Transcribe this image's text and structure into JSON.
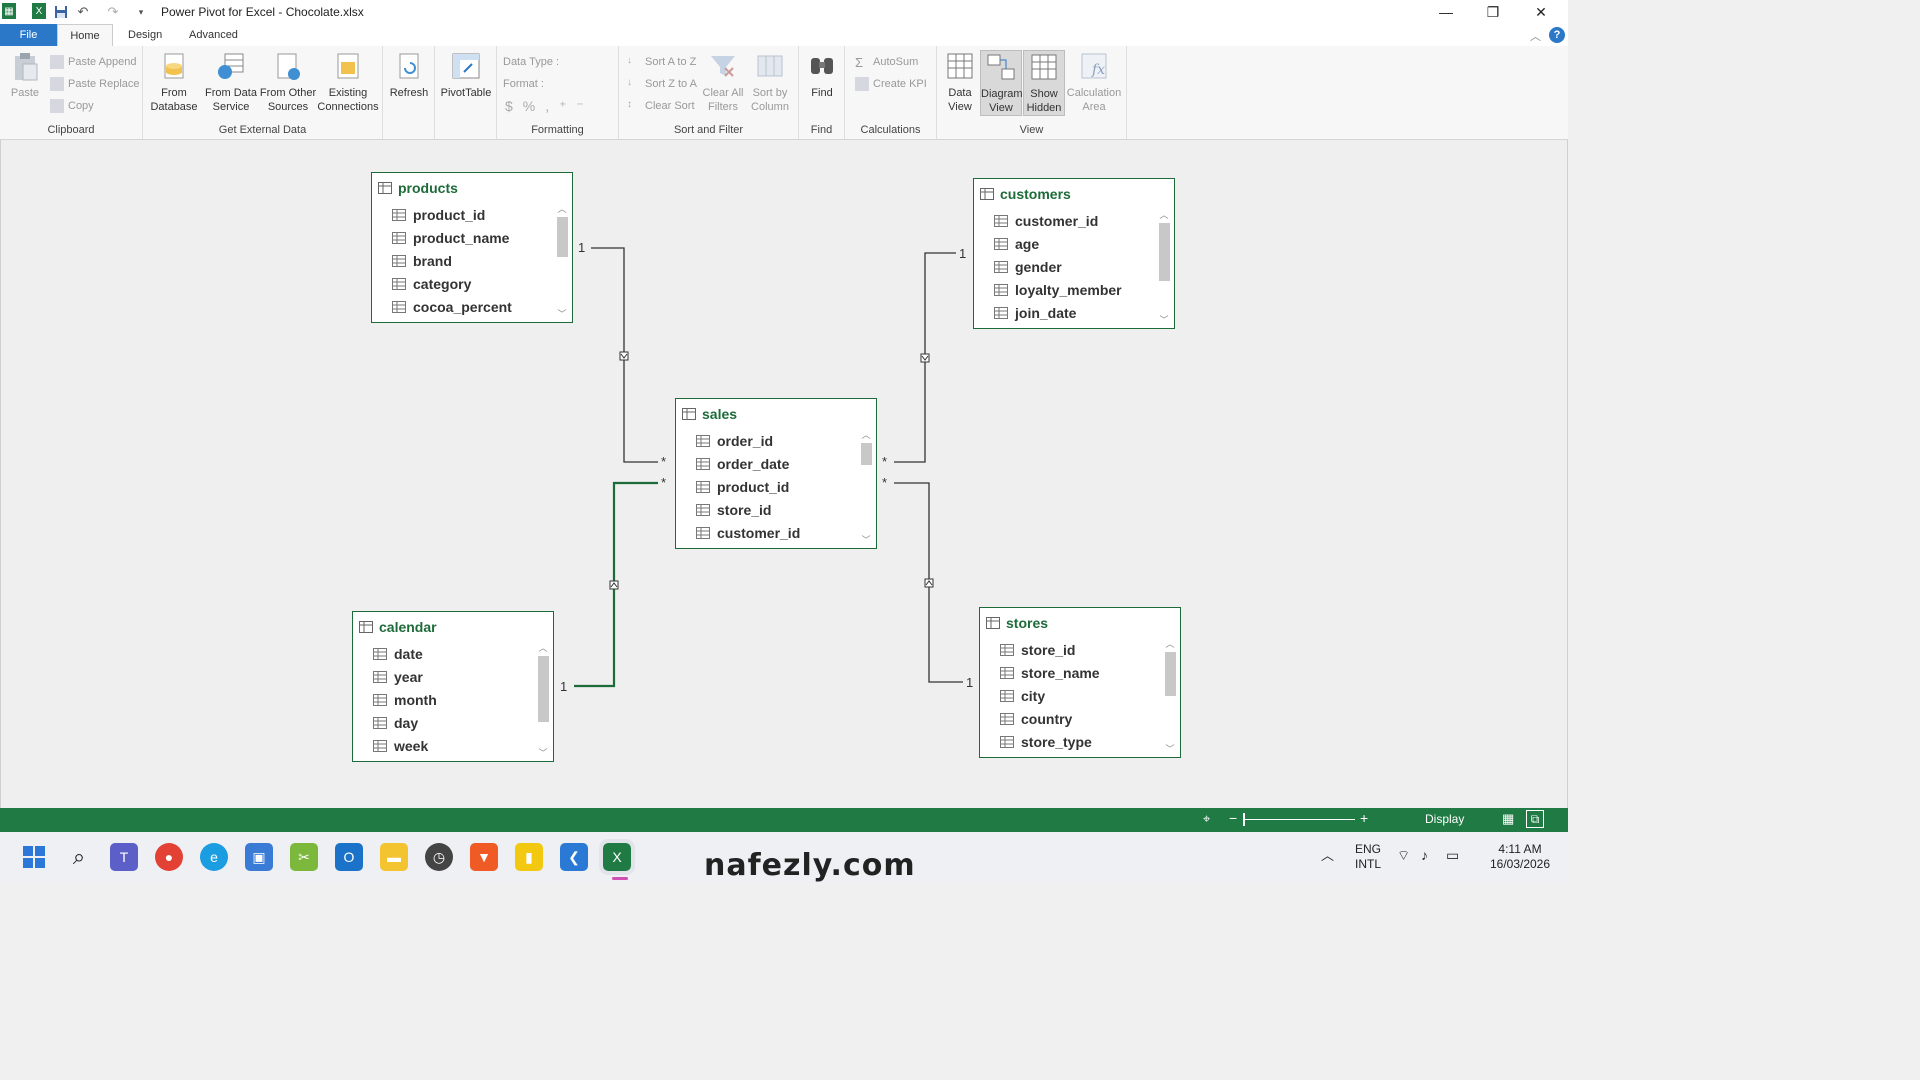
{
  "window": {
    "title": "Power Pivot for Excel - Chocolate.xlsx"
  },
  "tabs": [
    {
      "label": "File"
    },
    {
      "label": "Home"
    },
    {
      "label": "Design"
    },
    {
      "label": "Advanced"
    }
  ],
  "ribbon": {
    "clipboard": {
      "label": "Clipboard",
      "paste": "Paste",
      "paste_append": "Paste Append",
      "paste_replace": "Paste Replace",
      "copy": "Copy"
    },
    "external": {
      "label": "Get External Data",
      "from_database": "From Database",
      "from_data_service": "From Data Service",
      "from_other_sources": "From Other Sources",
      "existing_connections": "Existing Connections"
    },
    "refresh": "Refresh",
    "pivottable": "PivotTable",
    "formatting": {
      "label": "Formatting",
      "data_type": "Data Type :",
      "format": "Format :"
    },
    "sort_filter": {
      "label": "Sort and Filter",
      "sort_az": "Sort A to Z",
      "sort_za": "Sort Z to A",
      "clear_sort": "Clear Sort",
      "clear_all_filters": "Clear All Filters",
      "sort_by_column": "Sort by Column"
    },
    "find": {
      "label": "Find",
      "find": "Find"
    },
    "calculations": {
      "label": "Calculations",
      "autosum": "AutoSum",
      "create_kpi": "Create KPI"
    },
    "view": {
      "label": "View",
      "data_view": "Data View",
      "diagram_view": "Diagram View",
      "show_hidden": "Show Hidden",
      "calculation_area": "Calculation Area"
    }
  },
  "tables": {
    "products": {
      "name": "products",
      "columns": [
        "product_id",
        "product_name",
        "brand",
        "category",
        "cocoa_percent"
      ]
    },
    "customers": {
      "name": "customers",
      "columns": [
        "customer_id",
        "age",
        "gender",
        "loyalty_member",
        "join_date"
      ]
    },
    "sales": {
      "name": "sales",
      "columns": [
        "order_id",
        "order_date",
        "product_id",
        "store_id",
        "customer_id"
      ]
    },
    "calendar": {
      "name": "calendar",
      "columns": [
        "date",
        "year",
        "month",
        "day",
        "week"
      ]
    },
    "stores": {
      "name": "stores",
      "columns": [
        "store_id",
        "store_name",
        "city",
        "country",
        "store_type"
      ]
    }
  },
  "relationships": {
    "one": "1",
    "many": "*"
  },
  "statusbar": {
    "display": "Display"
  },
  "taskbar": {
    "lang1": "ENG",
    "lang2": "INTL",
    "time": "4:11 AM",
    "date": "16/03/2026"
  },
  "watermark": {
    "text": "nafezly.com"
  },
  "colors": {
    "accent": "#1f7a44",
    "file_tab": "#2b78c9",
    "table_title": "#1e6b3a"
  }
}
